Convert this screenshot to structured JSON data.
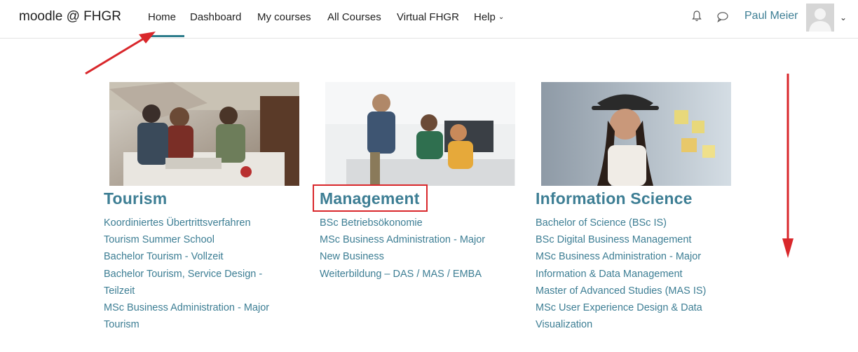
{
  "navbar": {
    "brand": "moodle @ FHGR",
    "items": [
      {
        "label": "Home"
      },
      {
        "label": "Dashboard"
      },
      {
        "label": "My courses"
      },
      {
        "label": "All Courses"
      },
      {
        "label": "Virtual FHGR"
      },
      {
        "label": "Help"
      }
    ],
    "active": "Home",
    "user_name": "Paul Meier"
  },
  "categories": [
    {
      "title": "Tourism",
      "links": [
        "Koordiniertes Übertrittsverfahren",
        "Tourism Summer School",
        "Bachelor Tourism - Vollzeit",
        "Bachelor Tourism, Service Design -",
        "Teilzeit",
        "MSc Business Administration - Major",
        "Tourism"
      ]
    },
    {
      "title": "Management",
      "links": [
        "BSc Betriebsökonomie",
        "MSc Business Administration - Major",
        "New Business",
        "Weiterbildung – DAS / MAS / EMBA"
      ]
    },
    {
      "title": "Information Science",
      "links": [
        "Bachelor of Science (BSc IS)",
        "BSc Digital Business Management",
        "MSc Business Administration - Major",
        "Information & Data Management",
        "Master of Advanced Studies (MAS IS)",
        "MSc User Experience Design & Data",
        "Visualization"
      ]
    }
  ],
  "colors": {
    "accent": "#3d7e94",
    "annotation": "#d9272b"
  }
}
